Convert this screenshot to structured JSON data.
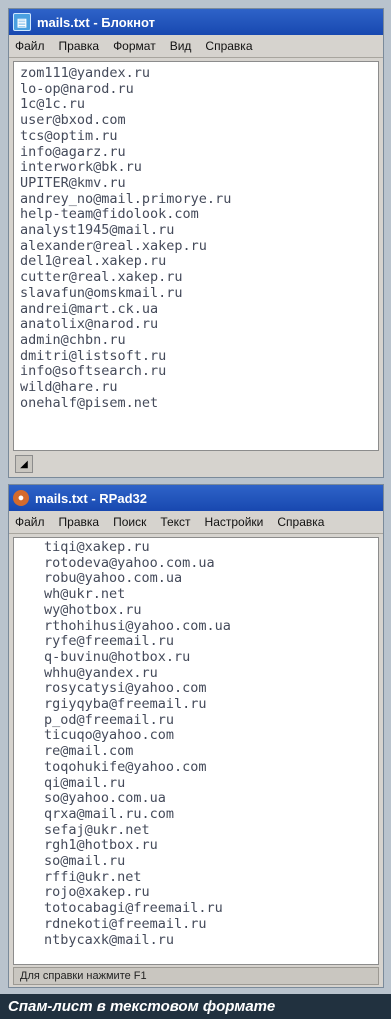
{
  "notepad": {
    "title": "mails.txt - Блокнот",
    "menu": [
      "Файл",
      "Правка",
      "Формат",
      "Вид",
      "Справка"
    ],
    "lines": [
      "zom111@yandex.ru",
      "lo-op@narod.ru",
      "1c@1c.ru",
      "user@bxod.com",
      "tcs@optim.ru",
      "info@agarz.ru",
      "interwork@bk.ru",
      "UPITER@kmv.ru",
      "andrey_no@mail.primorye.ru",
      "help-team@fidolook.com",
      "analyst1945@mail.ru",
      "alexander@real.xakep.ru",
      "del1@real.xakep.ru",
      "cutter@real.xakep.ru",
      "slavafun@omskmail.ru",
      "andrei@mart.ck.ua",
      "anatolix@narod.ru",
      "admin@chbn.ru",
      "dmitri@listsoft.ru",
      "info@softsearch.ru",
      "wild@hare.ru",
      "onehalf@pisem.net"
    ],
    "corner_glyph": "◢"
  },
  "rpad": {
    "title": "mails.txt - RPad32",
    "menu": [
      "Файл",
      "Правка",
      "Поиск",
      "Текст",
      "Настройки",
      "Справка"
    ],
    "lines": [
      "tiqi@xakep.ru",
      "rotodeva@yahoo.com.ua",
      "robu@yahoo.com.ua",
      "wh@ukr.net",
      "wy@hotbox.ru",
      "rthohihusi@yahoo.com.ua",
      "ryfe@freemail.ru",
      "q-buvinu@hotbox.ru",
      "whhu@yandex.ru",
      "rosycatysi@yahoo.com",
      "rgiyqyba@freemail.ru",
      "p_od@freemail.ru",
      "ticuqo@yahoo.com",
      "re@mail.com",
      "toqohukife@yahoo.com",
      "qi@mail.ru",
      "so@yahoo.com.ua",
      "qrxa@mail.ru.com",
      "sefaj@ukr.net",
      "rgh1@hotbox.ru",
      "so@mail.ru",
      "rffi@ukr.net",
      "rojo@xakep.ru",
      "totocabagi@freemail.ru",
      "rdnekoti@freemail.ru",
      "ntbycaxk@mail.ru"
    ],
    "status": "Для справки нажмите F1"
  },
  "caption": "Спам-лист в текстовом формате"
}
